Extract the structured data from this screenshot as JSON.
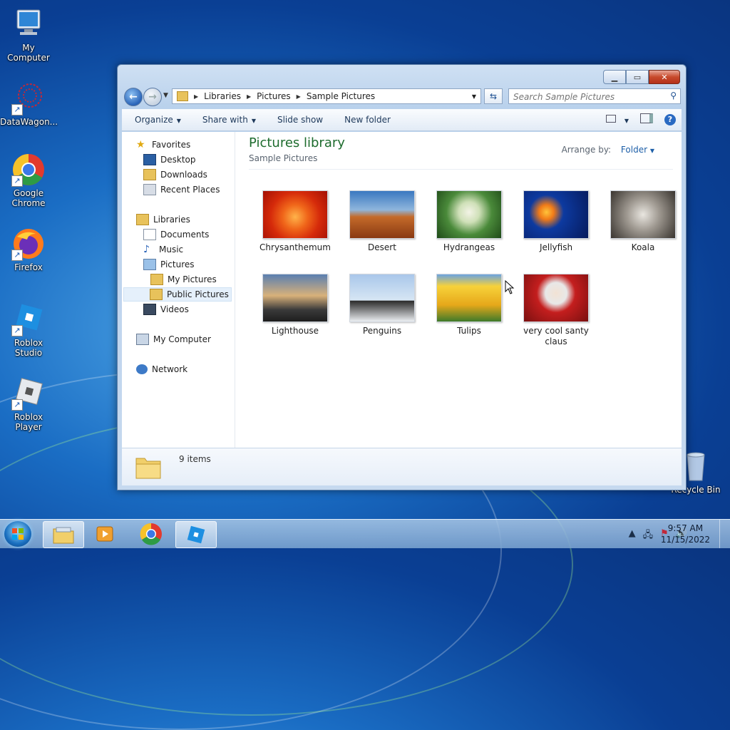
{
  "desktop": {
    "icons": [
      {
        "label": "My Computer"
      },
      {
        "label": "DataWagon..."
      },
      {
        "label": "Google Chrome"
      },
      {
        "label": "Firefox"
      },
      {
        "label": "Roblox Studio"
      },
      {
        "label": "Roblox Player"
      },
      {
        "label": "Recycle Bin"
      }
    ]
  },
  "window": {
    "address": {
      "segments": [
        "Libraries",
        "Pictures",
        "Sample Pictures"
      ]
    },
    "search": {
      "placeholder": "Search Sample Pictures"
    },
    "toolbar": {
      "organize": "Organize",
      "share": "Share with",
      "slideshow": "Slide show",
      "new_folder": "New folder"
    },
    "nav": {
      "favorites": "Favorites",
      "desktop": "Desktop",
      "downloads": "Downloads",
      "recent": "Recent Places",
      "libraries": "Libraries",
      "documents": "Documents",
      "music": "Music",
      "pictures": "Pictures",
      "my_pictures": "My Pictures",
      "public_pictures": "Public Pictures",
      "videos": "Videos",
      "my_computer": "My Computer",
      "network": "Network"
    },
    "header": {
      "title": "Pictures library",
      "subtitle": "Sample Pictures",
      "arrange_label": "Arrange by:",
      "arrange_value": "Folder"
    },
    "items": [
      {
        "name": "Chrysanthemum"
      },
      {
        "name": "Desert"
      },
      {
        "name": "Hydrangeas"
      },
      {
        "name": "Jellyfish"
      },
      {
        "name": "Koala"
      },
      {
        "name": "Lighthouse"
      },
      {
        "name": "Penguins"
      },
      {
        "name": "Tulips"
      },
      {
        "name": "very cool santy claus"
      }
    ],
    "status": {
      "count": "9 items"
    }
  },
  "taskbar": {
    "time": "9:57 AM",
    "date": "11/15/2022"
  }
}
